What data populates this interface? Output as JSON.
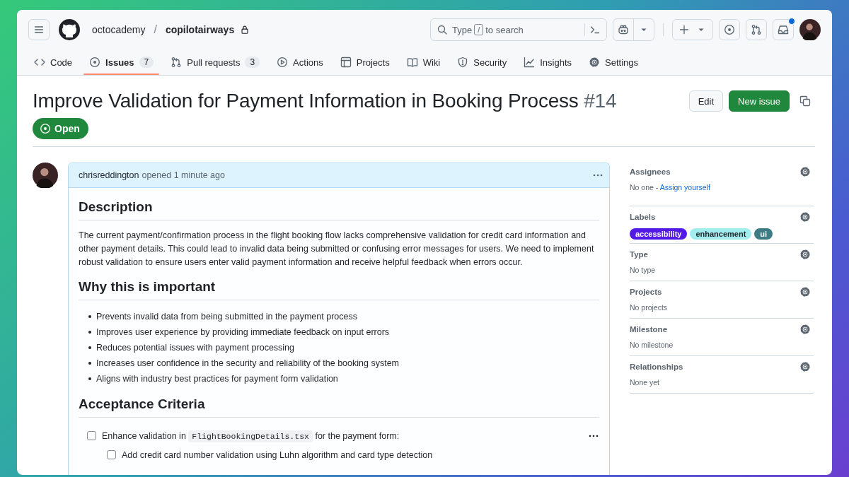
{
  "header": {
    "owner": "octocademy",
    "separator": "/",
    "repo": "copilotairways",
    "private": true,
    "search": {
      "before": "Type",
      "key": "/",
      "after": "to search"
    },
    "inbox_unread": true
  },
  "tabs": [
    {
      "label": "Code",
      "selected": false
    },
    {
      "label": "Issues",
      "count": "7",
      "selected": true
    },
    {
      "label": "Pull requests",
      "count": "3",
      "selected": false
    },
    {
      "label": "Actions",
      "selected": false
    },
    {
      "label": "Projects",
      "selected": false
    },
    {
      "label": "Wiki",
      "selected": false
    },
    {
      "label": "Security",
      "selected": false
    },
    {
      "label": "Insights",
      "selected": false
    },
    {
      "label": "Settings",
      "selected": false
    }
  ],
  "issue": {
    "title": "Improve Validation for Payment Information in Booking Process",
    "number": "#14",
    "state_label": "Open",
    "buttons": [
      "Edit",
      "New issue"
    ]
  },
  "comment": {
    "author": "chrisreddington",
    "meta": "opened 1 minute ago",
    "body": [
      {
        "kind": "heading",
        "text": "Description"
      },
      {
        "kind": "paragraph",
        "text": "The current payment/confirmation process in the flight booking flow lacks comprehensive validation for credit card information and other payment details. This could lead to invalid data being submitted or confusing error messages for users. We need to implement robust validation to ensure users enter valid payment information and receive helpful feedback when errors occur."
      },
      {
        "kind": "heading",
        "text": "Why this is important"
      },
      {
        "kind": "bullets",
        "items": [
          "Prevents invalid data from being submitted in the payment process",
          "Improves user experience by providing immediate feedback on input errors",
          "Reduces potential issues with payment processing",
          "Increases user confidence in the security and reliability of the booking system",
          "Aligns with industry best practices for payment form validation"
        ]
      },
      {
        "kind": "heading",
        "text": "Acceptance Criteria"
      },
      {
        "kind": "tasks",
        "items": [
          {
            "checked": false,
            "parts": [
              {
                "text": "Enhance validation in "
              },
              {
                "code": "FlightBookingDetails.tsx"
              },
              {
                "text": " for the payment form:"
              }
            ],
            "children": [
              {
                "checked": false,
                "parts": [
                  {
                    "text": "Add credit card number validation using Luhn algorithm and card type detection"
                  }
                ]
              }
            ]
          }
        ]
      }
    ]
  },
  "sidebar": [
    {
      "title": "Assignees",
      "value": "No one -",
      "link": "Assign yourself"
    },
    {
      "title": "Labels",
      "labels": [
        {
          "name": "accessibility",
          "color": "#5319e7"
        },
        {
          "name": "enhancement",
          "color": "#a2eeef"
        },
        {
          "name": "ui",
          "color": "#3e7c85"
        }
      ]
    },
    {
      "title": "Type",
      "value": "No type"
    },
    {
      "title": "Projects",
      "value": "No projects"
    },
    {
      "title": "Milestone",
      "value": "No milestone"
    },
    {
      "title": "Relationships",
      "value": "None yet"
    }
  ]
}
